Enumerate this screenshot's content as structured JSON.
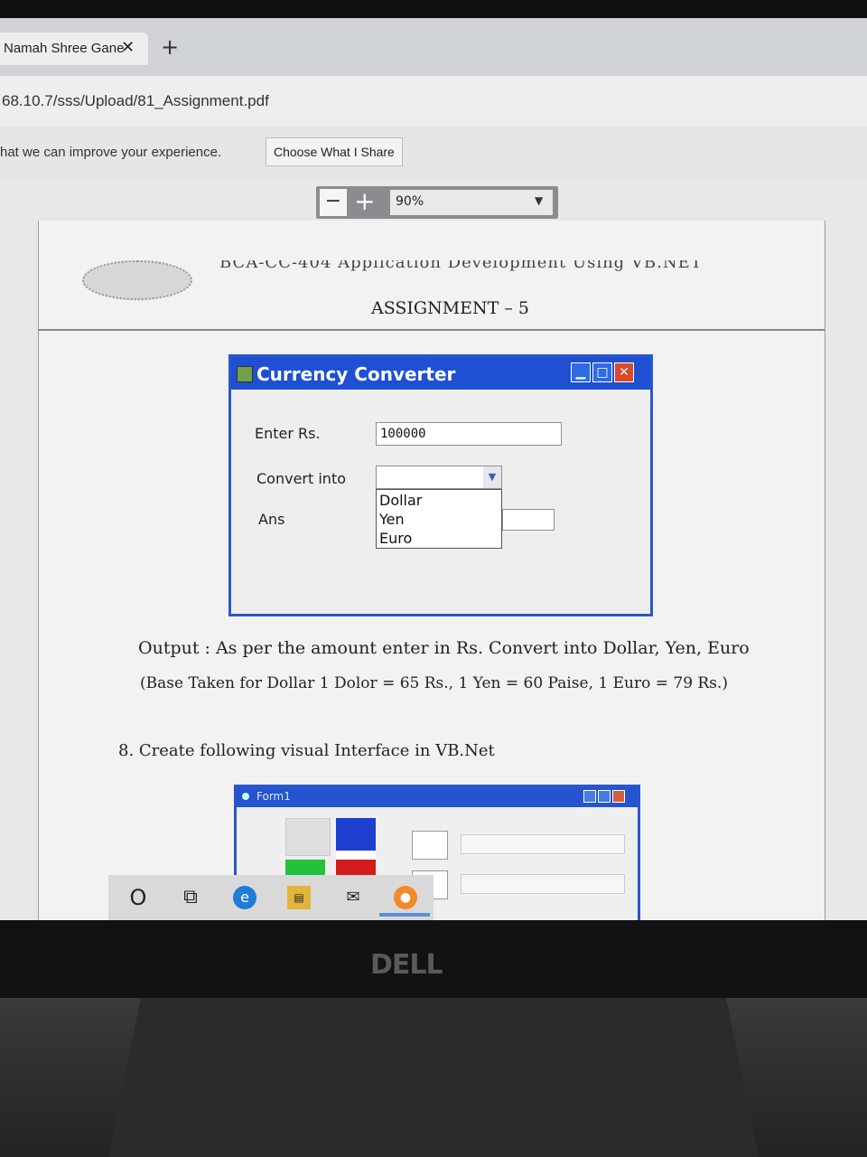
{
  "browser": {
    "tab_title": "Namah Shree Gane",
    "tab_close": "✕",
    "new_tab": "+",
    "address": "68.10.7/sss/Upload/81_Assignment.pdf",
    "infobar_text": "hat we can improve your experience.",
    "infobar_button": "Choose What I Share"
  },
  "pdf_toolbar": {
    "zoom_minus": "−",
    "zoom_plus": "+",
    "zoom_value": "90%",
    "caret": "▼"
  },
  "document": {
    "header_cut": "BCA-CC-404 Application Development Using VB.NET",
    "assignment_title": "ASSIGNMENT – 5",
    "output_line": "Output : As per the amount enter in Rs. Convert into Dollar, Yen, Euro",
    "base_line": "(Base Taken for Dollar 1 Dolor = 65 Rs., 1 Yen = 60 Paise, 1 Euro = 79 Rs.)",
    "question_8": "8. Create following visual Interface in VB.Net"
  },
  "currency_window": {
    "title": "Currency Converter",
    "minimize": "▁",
    "maximize": "□",
    "close": "✕",
    "enter_label": "Enter Rs.",
    "enter_value": "100000",
    "convert_label": "Convert into",
    "combo_caret": "▼",
    "options": [
      "Dollar",
      "Yen",
      "Euro"
    ],
    "ans_label": "Ans"
  },
  "form1_window": {
    "title": "Form1"
  },
  "taskbar": {
    "search_icon": "O",
    "task_view_icon": "⧉",
    "edge_icon": "e",
    "files_icon": "▤",
    "mail_icon": "✉",
    "firefox_icon": "●"
  },
  "monitor": {
    "brand": "DELL"
  },
  "colors": {
    "titlebar_blue": "#1f4fd3",
    "close_red": "#d84a2a",
    "form_blue_box": "#1c3fd0",
    "form_green_box": "#22c23a",
    "form_red_box": "#d41a1a"
  }
}
